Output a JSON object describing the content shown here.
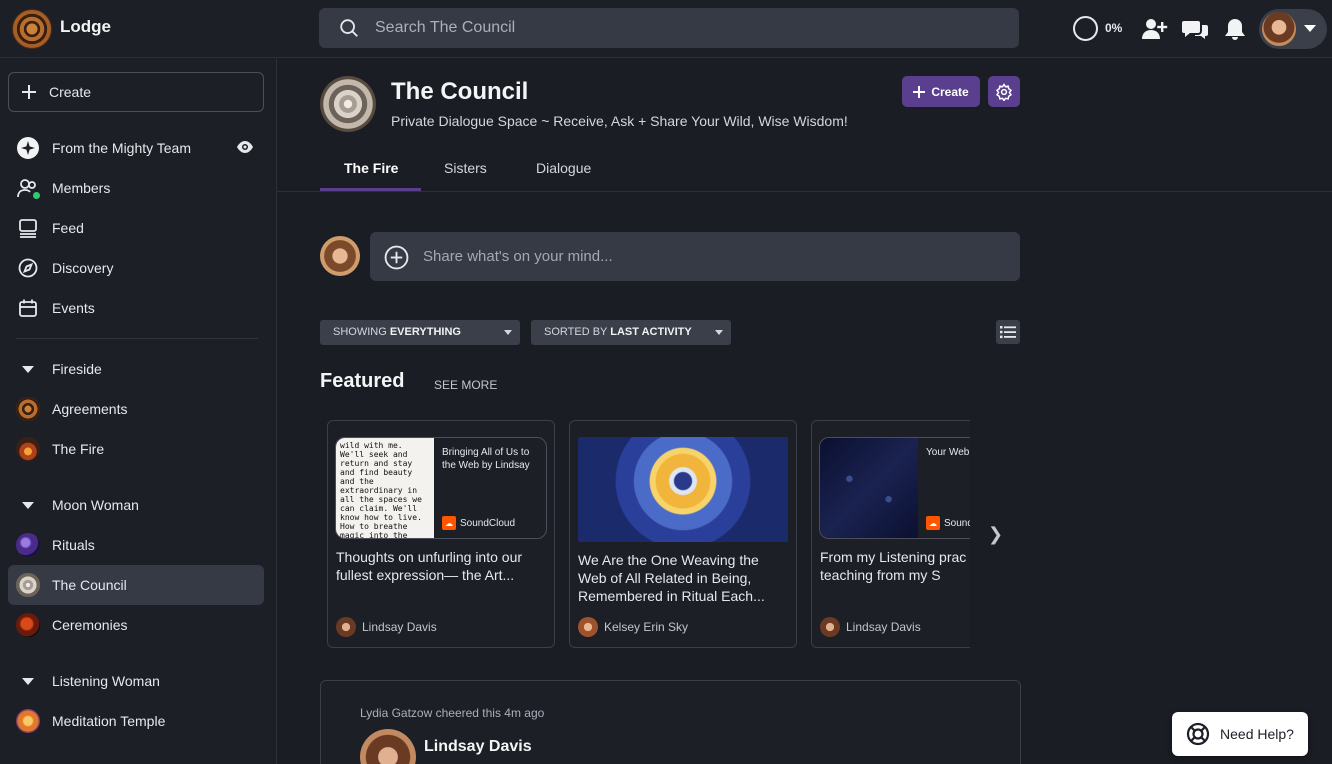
{
  "app": {
    "name": "Lodge"
  },
  "search": {
    "placeholder": "Search The Council"
  },
  "header_bar": {
    "progress": "0%",
    "icons": [
      "invite-user-icon",
      "chat-icon",
      "bell-icon"
    ]
  },
  "sidebar": {
    "create_label": "Create",
    "top_items": [
      {
        "label": "From the Mighty Team",
        "icon": "sparkle-icon"
      },
      {
        "label": "Members",
        "icon": "members-icon"
      },
      {
        "label": "Feed",
        "icon": "feed-icon"
      },
      {
        "label": "Discovery",
        "icon": "compass-icon"
      },
      {
        "label": "Events",
        "icon": "calendar-icon"
      }
    ],
    "sections": [
      {
        "label": "Fireside",
        "items": [
          "Agreements",
          "The Fire"
        ]
      },
      {
        "label": "Moon Woman",
        "items": [
          "Rituals",
          "The Council",
          "Ceremonies"
        ]
      },
      {
        "label": "Listening Woman",
        "items": [
          "Meditation Temple"
        ]
      }
    ]
  },
  "space": {
    "title": "The Council",
    "subtitle": "Private Dialogue Space ~ Receive, Ask + Share Your Wild, Wise Wisdom!",
    "create_label": "Create",
    "tabs": [
      "The Fire",
      "Sisters",
      "Dialogue"
    ]
  },
  "composer": {
    "placeholder": "Share what's on your mind..."
  },
  "filters": {
    "showing_prefix": "SHOWING",
    "showing_value": "EVERYTHING",
    "sorted_prefix": "SORTED BY",
    "sorted_value": "LAST ACTIVITY"
  },
  "featured": {
    "title": "Featured",
    "see_more": "SEE MORE",
    "cards": [
      {
        "preview_text": "wild with me. We'll seek and return and stay and find beauty and the extraordinary in all the spaces we can claim. We'll know how to live. How to breathe magic into the mundane.\"",
        "preview_label": "Bringing All of Us to the Web by Lindsay",
        "preview_source": "SoundCloud",
        "title": "Thoughts on unfurling into our fullest expression— the Art...",
        "author": "Lindsay Davis"
      },
      {
        "title": "We Are the One Weaving the Web of All Related in Being, Remembered in Ritual Each...",
        "author": "Kelsey Erin Sky"
      },
      {
        "preview_label": "Your Web of Connec",
        "preview_source": "Sound",
        "title": "From my Listening prac the teaching from my S",
        "author": "Lindsay Davis"
      }
    ]
  },
  "post": {
    "cheer": "Lydia Gatzow cheered this 4m ago",
    "author": "Lindsay Davis"
  },
  "help": {
    "label": "Need Help?"
  },
  "colors": {
    "accent": "#5a3f8e",
    "background": "#1a1d24",
    "panel": "#353a44"
  }
}
